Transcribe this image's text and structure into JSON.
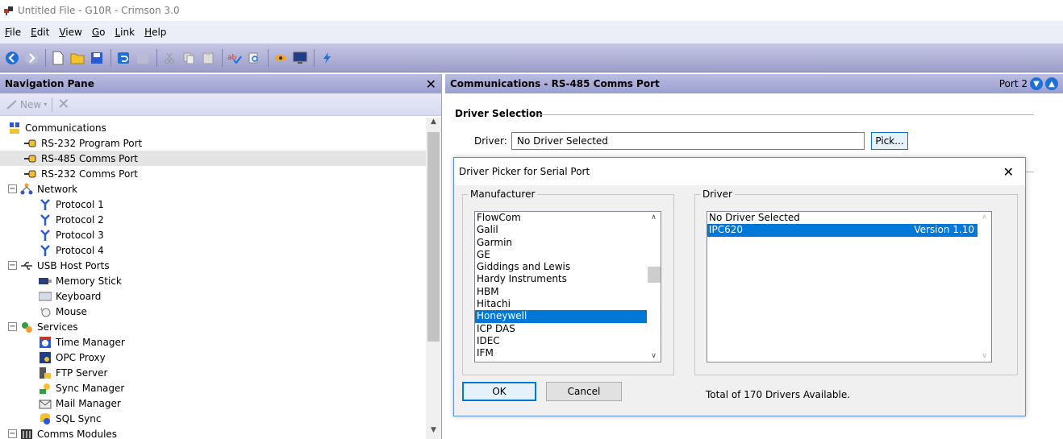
{
  "window": {
    "title": "Untitled File - G10R - Crimson 3.0"
  },
  "menu": [
    {
      "label": "File"
    },
    {
      "label": "Edit"
    },
    {
      "label": "View"
    },
    {
      "label": "Go"
    },
    {
      "label": "Link"
    },
    {
      "label": "Help"
    }
  ],
  "nav": {
    "title": "Navigation Pane",
    "new_label": "New",
    "tree": [
      {
        "label": "Communications",
        "icon": "communications-icon",
        "level": 0,
        "expander": ""
      },
      {
        "label": "RS-232 Program Port",
        "icon": "serial-port-icon",
        "level": 1,
        "expander": ""
      },
      {
        "label": "RS-485 Comms Port",
        "icon": "serial-port-icon",
        "level": 1,
        "expander": "",
        "selected": true
      },
      {
        "label": "RS-232 Comms Port",
        "icon": "serial-port-icon",
        "level": 1,
        "expander": ""
      },
      {
        "label": "Network",
        "icon": "network-icon",
        "level": 0,
        "expander": "−"
      },
      {
        "label": "Protocol 1",
        "icon": "protocol-icon",
        "level": 2,
        "expander": ""
      },
      {
        "label": "Protocol 2",
        "icon": "protocol-icon",
        "level": 2,
        "expander": ""
      },
      {
        "label": "Protocol 3",
        "icon": "protocol-icon",
        "level": 2,
        "expander": ""
      },
      {
        "label": "Protocol 4",
        "icon": "protocol-icon",
        "level": 2,
        "expander": ""
      },
      {
        "label": "USB Host Ports",
        "icon": "usb-icon",
        "level": 0,
        "expander": "−"
      },
      {
        "label": "Memory Stick",
        "icon": "memory-stick-icon",
        "level": 2,
        "expander": ""
      },
      {
        "label": "Keyboard",
        "icon": "keyboard-icon",
        "level": 2,
        "expander": ""
      },
      {
        "label": "Mouse",
        "icon": "mouse-icon",
        "level": 2,
        "expander": ""
      },
      {
        "label": "Services",
        "icon": "services-icon",
        "level": 0,
        "expander": "−"
      },
      {
        "label": "Time Manager",
        "icon": "time-manager-icon",
        "level": 2,
        "expander": ""
      },
      {
        "label": "OPC Proxy",
        "icon": "opc-proxy-icon",
        "level": 2,
        "expander": ""
      },
      {
        "label": "FTP Server",
        "icon": "ftp-server-icon",
        "level": 2,
        "expander": ""
      },
      {
        "label": "Sync Manager",
        "icon": "sync-manager-icon",
        "level": 2,
        "expander": ""
      },
      {
        "label": "Mail Manager",
        "icon": "mail-manager-icon",
        "level": 2,
        "expander": ""
      },
      {
        "label": "SQL Sync",
        "icon": "sql-sync-icon",
        "level": 2,
        "expander": ""
      },
      {
        "label": "Comms Modules",
        "icon": "comms-modules-icon",
        "level": 0,
        "expander": "−"
      }
    ]
  },
  "right": {
    "title": "Communications - RS-485 Comms Port",
    "port_label": "Port 2",
    "section_title": "Driver Selection",
    "driver_label": "Driver:",
    "driver_value": "No Driver Selected",
    "pick_label": "Pick..."
  },
  "dialog": {
    "title": "Driver Picker for Serial Port",
    "manufacturer_label": "Manufacturer",
    "driver_label": "Driver",
    "manufacturers": [
      "FlowCom",
      "Galil",
      "Garmin",
      "GE",
      "Giddings and Lewis",
      "Hardy Instruments",
      "HBM",
      "Hitachi",
      "Honeywell",
      "ICP DAS",
      "IDEC",
      "IFM"
    ],
    "selected_manufacturer": "Honeywell",
    "drivers": [
      {
        "name": "No Driver Selected",
        "version": ""
      },
      {
        "name": "IPC620",
        "version": "Version 1.10",
        "selected": true
      }
    ],
    "ok_label": "OK",
    "cancel_label": "Cancel",
    "total_text": "Total of 170 Drivers Available."
  },
  "colors": {
    "selection": "#0078d7",
    "header_gradient": "#9b9fd0",
    "accent": "#1f6fd6"
  }
}
